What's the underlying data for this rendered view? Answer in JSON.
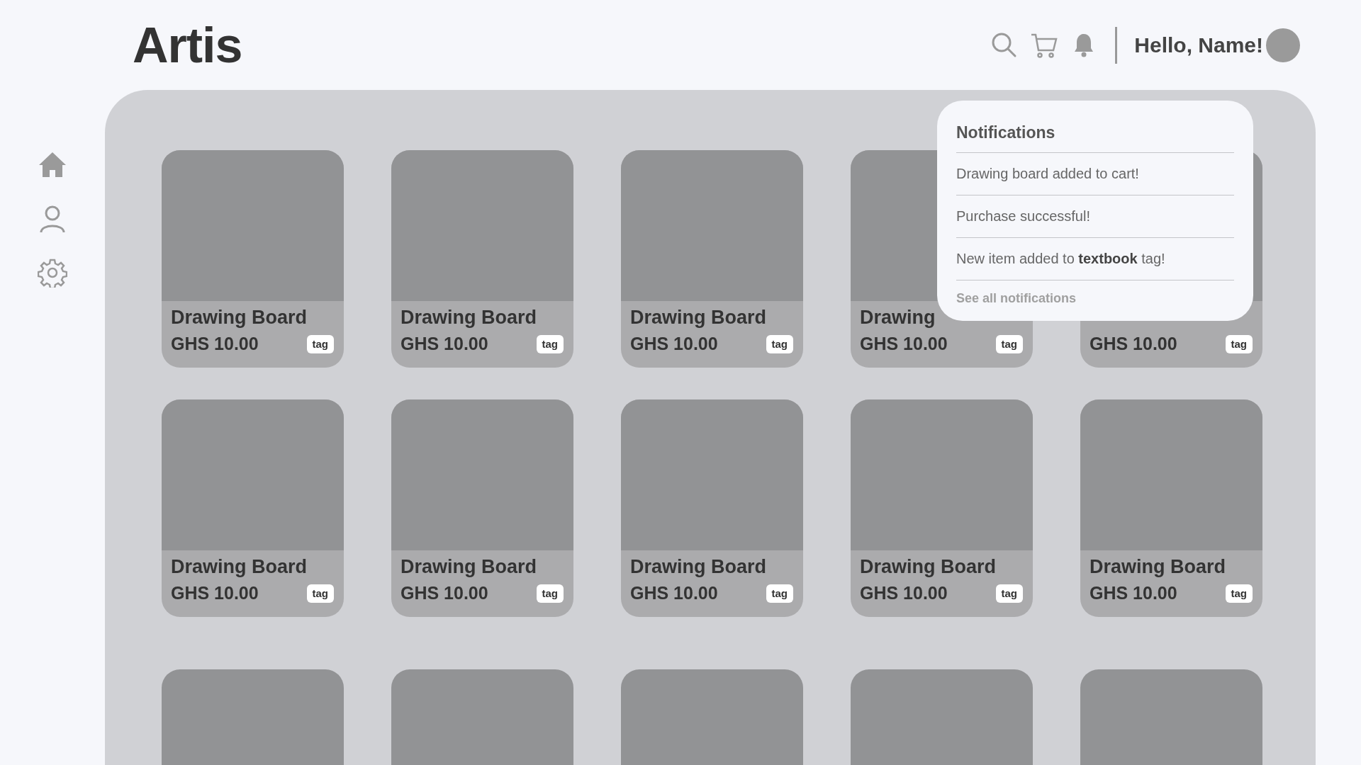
{
  "logo": "Artis",
  "header": {
    "greeting": "Hello, Name!"
  },
  "sidebar": {
    "items": [
      {
        "kind": "home"
      },
      {
        "kind": "profile"
      },
      {
        "kind": "settings"
      }
    ]
  },
  "products": [
    {
      "kind": "card",
      "title": "Drawing Board",
      "price": "GHS 10.00",
      "tag": "tag"
    },
    {
      "kind": "card",
      "title": "Drawing Board",
      "price": "GHS 10.00",
      "tag": "tag"
    },
    {
      "kind": "card",
      "title": "Drawing Board",
      "price": "GHS 10.00",
      "tag": "tag"
    },
    {
      "kind": "card",
      "title": "Drawing",
      "price": "GHS 10.00",
      "tag": "tag"
    },
    {
      "kind": "card",
      "price": "GHS 10.00",
      "tag": "tag"
    },
    {
      "kind": "card",
      "title": "Drawing Board",
      "price": "GHS 10.00",
      "tag": "tag"
    },
    {
      "kind": "card",
      "title": "Drawing Board",
      "price": "GHS 10.00",
      "tag": "tag"
    },
    {
      "kind": "card",
      "title": "Drawing Board",
      "price": "GHS 10.00",
      "tag": "tag"
    },
    {
      "kind": "card",
      "title": "Drawing Board",
      "price": "GHS 10.00",
      "tag": "tag"
    },
    {
      "kind": "card",
      "title": "Drawing Board",
      "price": "GHS 10.00",
      "tag": "tag"
    },
    {
      "kind": "image-only"
    },
    {
      "kind": "image-only"
    },
    {
      "kind": "image-only"
    },
    {
      "kind": "image-only"
    },
    {
      "kind": "image-only"
    }
  ],
  "notifications": {
    "title": "Notifications",
    "items": [
      "Drawing board added to cart!",
      "Purchase successful!",
      "New item added to **textbook** tag!"
    ],
    "footer_link": "See all notifications"
  }
}
